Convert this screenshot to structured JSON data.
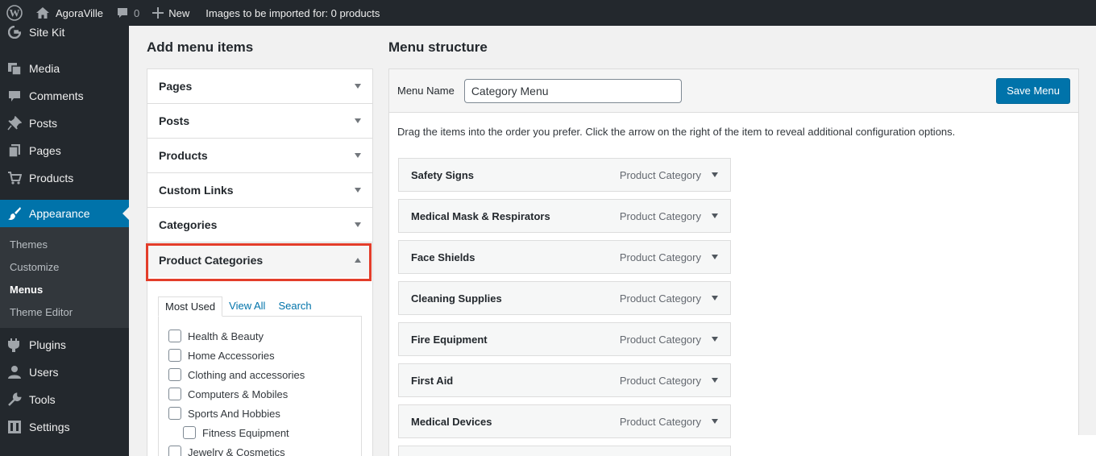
{
  "admin_bar": {
    "site_name": "AgoraVille",
    "comments_count": "0",
    "new_label": "New",
    "import_status": "Images to be imported for: 0 products"
  },
  "sidebar": {
    "items": [
      {
        "label": "Site Kit",
        "icon": "google-g-icon"
      },
      {
        "label": "Media",
        "icon": "media-icon"
      },
      {
        "label": "Comments",
        "icon": "comment-icon"
      },
      {
        "label": "Posts",
        "icon": "pin-icon"
      },
      {
        "label": "Pages",
        "icon": "pages-icon"
      },
      {
        "label": "Products",
        "icon": "cart-icon"
      },
      {
        "label": "Appearance",
        "icon": "paintbrush-icon",
        "active": true
      },
      {
        "label": "Plugins",
        "icon": "plugin-icon"
      },
      {
        "label": "Users",
        "icon": "users-icon"
      },
      {
        "label": "Tools",
        "icon": "wrench-icon"
      },
      {
        "label": "Settings",
        "icon": "settings-icon"
      }
    ],
    "appearance_submenu": [
      "Themes",
      "Customize",
      "Menus",
      "Theme Editor"
    ],
    "current_submenu": "Menus"
  },
  "add_items": {
    "title": "Add menu items",
    "sections": [
      "Pages",
      "Posts",
      "Products",
      "Custom Links",
      "Categories",
      "Product Categories"
    ],
    "open_section": "Product Categories",
    "tabs": [
      "Most Used",
      "View All",
      "Search"
    ],
    "active_tab": "Most Used",
    "checkboxes": [
      {
        "label": "Health & Beauty",
        "child": false
      },
      {
        "label": "Home Accessories",
        "child": false
      },
      {
        "label": "Clothing and accessories",
        "child": false
      },
      {
        "label": "Computers & Mobiles",
        "child": false
      },
      {
        "label": "Sports And Hobbies",
        "child": false
      },
      {
        "label": "Fitness Equipment",
        "child": true
      },
      {
        "label": "Jewelry & Cosmetics",
        "child": false
      }
    ]
  },
  "menu_structure": {
    "title": "Menu structure",
    "menu_name_label": "Menu Name",
    "menu_name_value": "Category Menu",
    "save_label": "Save Menu",
    "instructions": "Drag the items into the order you prefer. Click the arrow on the right of the item to reveal additional configuration options.",
    "items": [
      {
        "title": "Safety Signs",
        "type": "Product Category"
      },
      {
        "title": "Medical Mask & Respirators",
        "type": "Product Category"
      },
      {
        "title": "Face Shields",
        "type": "Product Category"
      },
      {
        "title": "Cleaning Supplies",
        "type": "Product Category"
      },
      {
        "title": "Fire Equipment",
        "type": "Product Category"
      },
      {
        "title": "First Aid",
        "type": "Product Category"
      },
      {
        "title": "Medical Devices",
        "type": "Product Category"
      }
    ]
  },
  "colors": {
    "admin_dark": "#23282d",
    "accent_blue": "#0073aa",
    "highlight_red": "#e33d2a"
  }
}
